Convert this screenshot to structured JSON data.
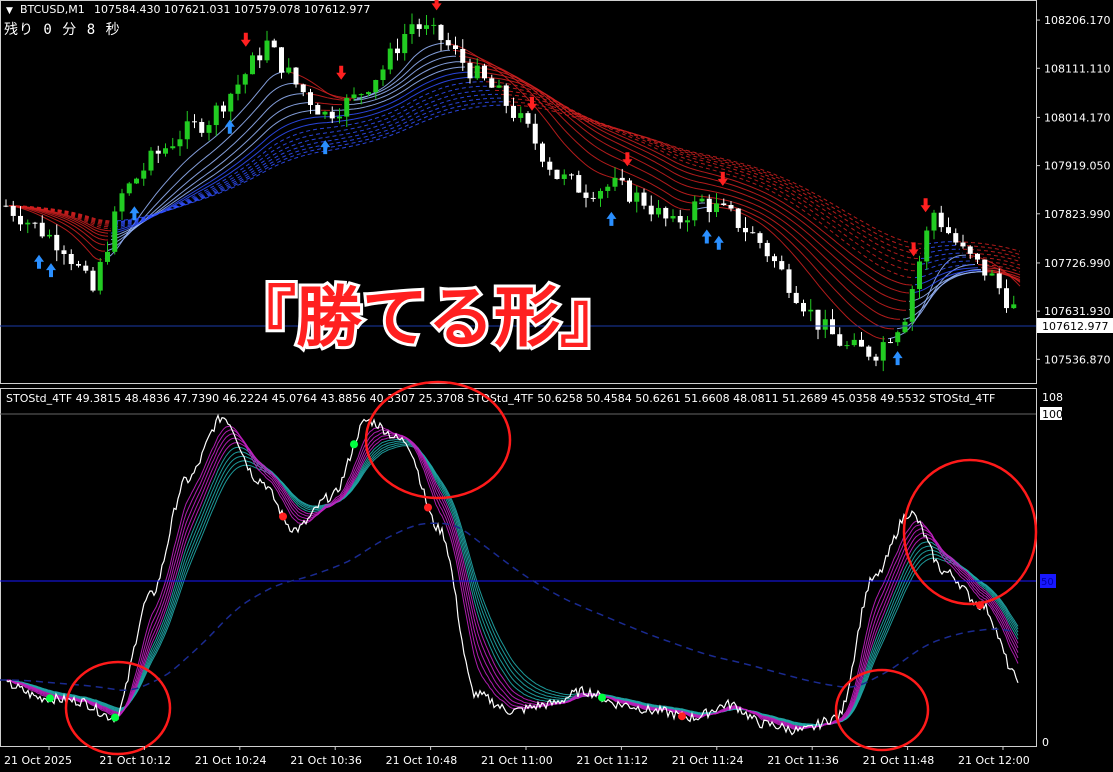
{
  "header": {
    "symbol": "BTCUSD,M1",
    "ohlc": "107584.430 107621.031 107579.078 107612.977",
    "timer": "残り 0 分 8 秒"
  },
  "overlay_text": "『勝てる形』",
  "indicator": {
    "header": "STOStd_4TF 49.3815 48.4836 47.7390 46.2224 45.0764 43.8856 40.3307 25.3708  STOStd_4TF 50.6258 50.4584 50.6261 51.6608 48.0811 51.2689 45.0358 49.5532  STOStd_4TF",
    "scale_top": "108",
    "scale_100": "100",
    "level_50": "50",
    "scale_bottom": "0"
  },
  "colors": {
    "background": "#000000",
    "bull_candle": "#22cc22",
    "bear_candle": "#ffffff",
    "ribbon_red": "#d02020",
    "ribbon_blue": "#3050ff",
    "buy_arrow": "#2a8fff",
    "sell_arrow": "#ff2020",
    "stoch_main": "#ffffff",
    "stoch_magenta": "#c020c0",
    "stoch_teal": "#20a8a8",
    "level_line": "#1818ff",
    "dashed_line": "#1a2a90",
    "circle": "#ff1a1a",
    "dot_green": "#00ff40",
    "dot_red": "#ff2020"
  },
  "chart_data": {
    "type": "line",
    "price_axis": {
      "ticks": [
        "108206.170",
        "108111.110",
        "108014.170",
        "107919.050",
        "107823.990",
        "107726.990",
        "107631.930",
        "107536.870"
      ],
      "current_price": "107612.977",
      "ylim": [
        107500,
        108230
      ]
    },
    "time_axis": {
      "labels": [
        "21 Oct 2025",
        "21 Oct 10:12",
        "21 Oct 10:24",
        "21 Oct 10:36",
        "21 Oct 10:48",
        "21 Oct 11:00",
        "21 Oct 11:12",
        "21 Oct 11:24",
        "21 Oct 11:36",
        "21 Oct 11:48",
        "21 Oct 12:00"
      ]
    },
    "price_close": [
      107840,
      107800,
      107760,
      107670,
      107860,
      107930,
      107980,
      108010,
      108080,
      108160,
      108080,
      108020,
      108050,
      108110,
      108200,
      108170,
      108110,
      108060,
      107990,
      107900,
      107870,
      107880,
      107850,
      107800,
      107850,
      107820,
      107770,
      107690,
      107610,
      107560,
      107550,
      107620,
      107830,
      107750,
      107700,
      107620
    ],
    "stochastic_main": [
      18,
      14,
      13,
      8,
      45,
      80,
      99,
      80,
      65,
      75,
      98,
      92,
      65,
      15,
      10,
      12,
      16,
      12,
      10,
      8,
      12,
      6,
      4,
      8,
      50,
      70,
      52,
      42,
      20
    ],
    "markers": {
      "buy": [
        "21 Oct 2025",
        "21 Oct 2025",
        "21 Oct 10:12",
        "21 Oct 10:24",
        "21 Oct 10:36",
        "21 Oct 11:12",
        "21 Oct 11:24",
        "21 Oct 11:24",
        "21 Oct 11:48"
      ],
      "sell": [
        "21 Oct 10:24",
        "21 Oct 10:36",
        "21 Oct 10:48",
        "21 Oct 11:00",
        "21 Oct 11:12",
        "21 Oct 11:24",
        "21 Oct 11:48",
        "21 Oct 11:48"
      ]
    }
  }
}
